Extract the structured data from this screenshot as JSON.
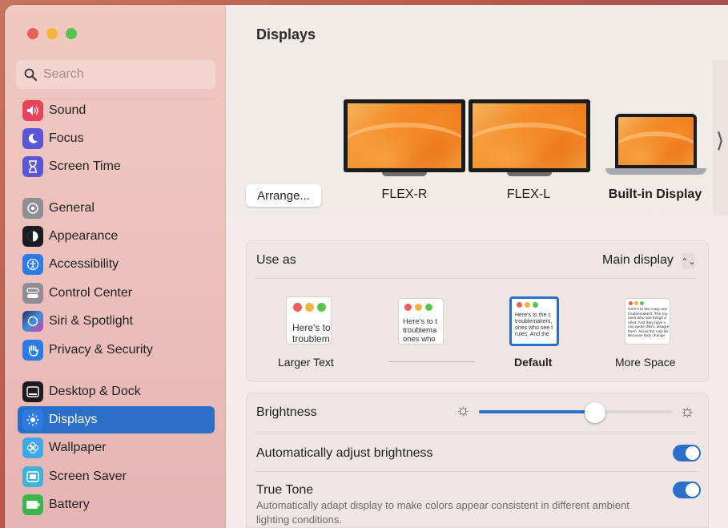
{
  "window": {
    "title": "Displays"
  },
  "search": {
    "placeholder": "Search"
  },
  "sidebar": {
    "items": [
      {
        "label": "Sound",
        "icon": "speaker-icon",
        "color": "#e9435a"
      },
      {
        "label": "Focus",
        "icon": "moon-icon",
        "color": "#5a56d6"
      },
      {
        "label": "Screen Time",
        "icon": "hourglass-icon",
        "color": "#5a56d6"
      },
      {
        "label": "General",
        "icon": "gear-icon",
        "color": "#8e8e93"
      },
      {
        "label": "Appearance",
        "icon": "appearance-icon",
        "color": "#1c1c1e"
      },
      {
        "label": "Accessibility",
        "icon": "accessibility-icon",
        "color": "#2c7be5"
      },
      {
        "label": "Control Center",
        "icon": "control-center-icon",
        "color": "#8e8e93"
      },
      {
        "label": "Siri & Spotlight",
        "icon": "siri-icon",
        "color": "#3b3b8f"
      },
      {
        "label": "Privacy & Security",
        "icon": "hand-icon",
        "color": "#2c7be5"
      },
      {
        "label": "Desktop & Dock",
        "icon": "dock-icon",
        "color": "#1c1c1e"
      },
      {
        "label": "Displays",
        "icon": "sun-icon",
        "color": "#2c7be5",
        "active": true
      },
      {
        "label": "Wallpaper",
        "icon": "flower-icon",
        "color": "#3fa8e8"
      },
      {
        "label": "Screen Saver",
        "icon": "screen-saver-icon",
        "color": "#3fb2d8"
      },
      {
        "label": "Battery",
        "icon": "battery-icon",
        "color": "#3cb54a"
      }
    ]
  },
  "displays": {
    "arrange_label": "Arrange...",
    "items": [
      {
        "label": "FLEX-R",
        "selected": false
      },
      {
        "label": "FLEX-L",
        "selected": false
      },
      {
        "label": "Built-in Display",
        "selected": true
      }
    ]
  },
  "use_as": {
    "label": "Use as",
    "value": "Main display",
    "presets": [
      {
        "label": "Larger Text",
        "sample": "Here's to\ntroublem"
      },
      {
        "label": "",
        "sample": "Here's to t\ntroublema\nones who"
      },
      {
        "label": "Default",
        "sample": "Here's to the c\ntroublemakers,\nones who see t\nrules. And the",
        "selected": true
      },
      {
        "label": "More Space",
        "sample": "Here's to the crazy one\ntroublemakers. The rou\nones who see things d\nrules. And they have n\ncan quote them, disagre\nthem. About the only thi\nBecause they change"
      }
    ]
  },
  "brightness": {
    "label": "Brightness",
    "value": 0.6
  },
  "auto_brightness": {
    "label": "Automatically adjust brightness",
    "on": true
  },
  "true_tone": {
    "label": "True Tone",
    "on": true,
    "description": "Automatically adapt display to make colors appear consistent in different ambient lighting conditions."
  },
  "colors": {
    "accent": "#2c6fc9"
  }
}
